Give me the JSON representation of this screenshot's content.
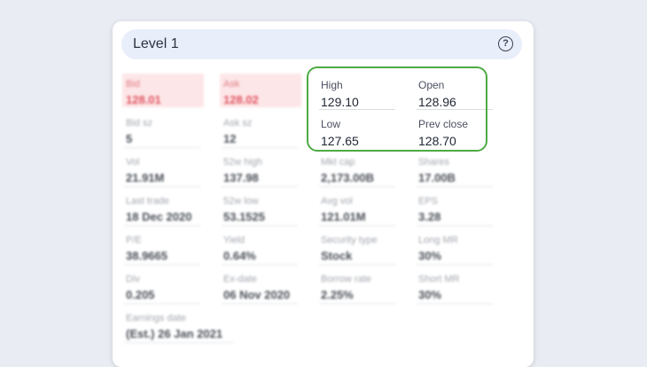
{
  "panel": {
    "title": "Level 1",
    "help_icon": "question-circle-icon"
  },
  "quote_fields": [
    {
      "label": "Bid",
      "value": "128.01"
    },
    {
      "label": "Ask",
      "value": "128.02"
    },
    {
      "label": "Bid sz",
      "value": "5"
    },
    {
      "label": "Ask sz",
      "value": "12"
    },
    {
      "label": "Vol",
      "value": "21.91M"
    },
    {
      "label": "52w high",
      "value": "137.98"
    },
    {
      "label": "Mkt cap",
      "value": "2,173.00B"
    },
    {
      "label": "Shares",
      "value": "17.00B"
    },
    {
      "label": "Last trade",
      "value": "18 Dec 2020"
    },
    {
      "label": "52w low",
      "value": "53.1525"
    },
    {
      "label": "Avg vol",
      "value": "121.01M"
    },
    {
      "label": "EPS",
      "value": "3.28"
    },
    {
      "label": "P/E",
      "value": "38.9665"
    },
    {
      "label": "Yield",
      "value": "0.64%"
    },
    {
      "label": "Security type",
      "value": "Stock"
    },
    {
      "label": "Long MR",
      "value": "30%"
    },
    {
      "label": "Div",
      "value": "0.205"
    },
    {
      "label": "Ex-date",
      "value": "06 Nov 2020"
    },
    {
      "label": "Borrow rate",
      "value": "2.25%"
    },
    {
      "label": "Short MR",
      "value": "30%"
    },
    {
      "label": "Earnings date",
      "value": "(Est.) 26 Jan 2021"
    }
  ],
  "highlighted_fields": [
    {
      "label": "High",
      "value": "129.10"
    },
    {
      "label": "Open",
      "value": "128.96"
    },
    {
      "label": "Low",
      "value": "127.65"
    },
    {
      "label": "Prev close",
      "value": "128.70"
    }
  ]
}
